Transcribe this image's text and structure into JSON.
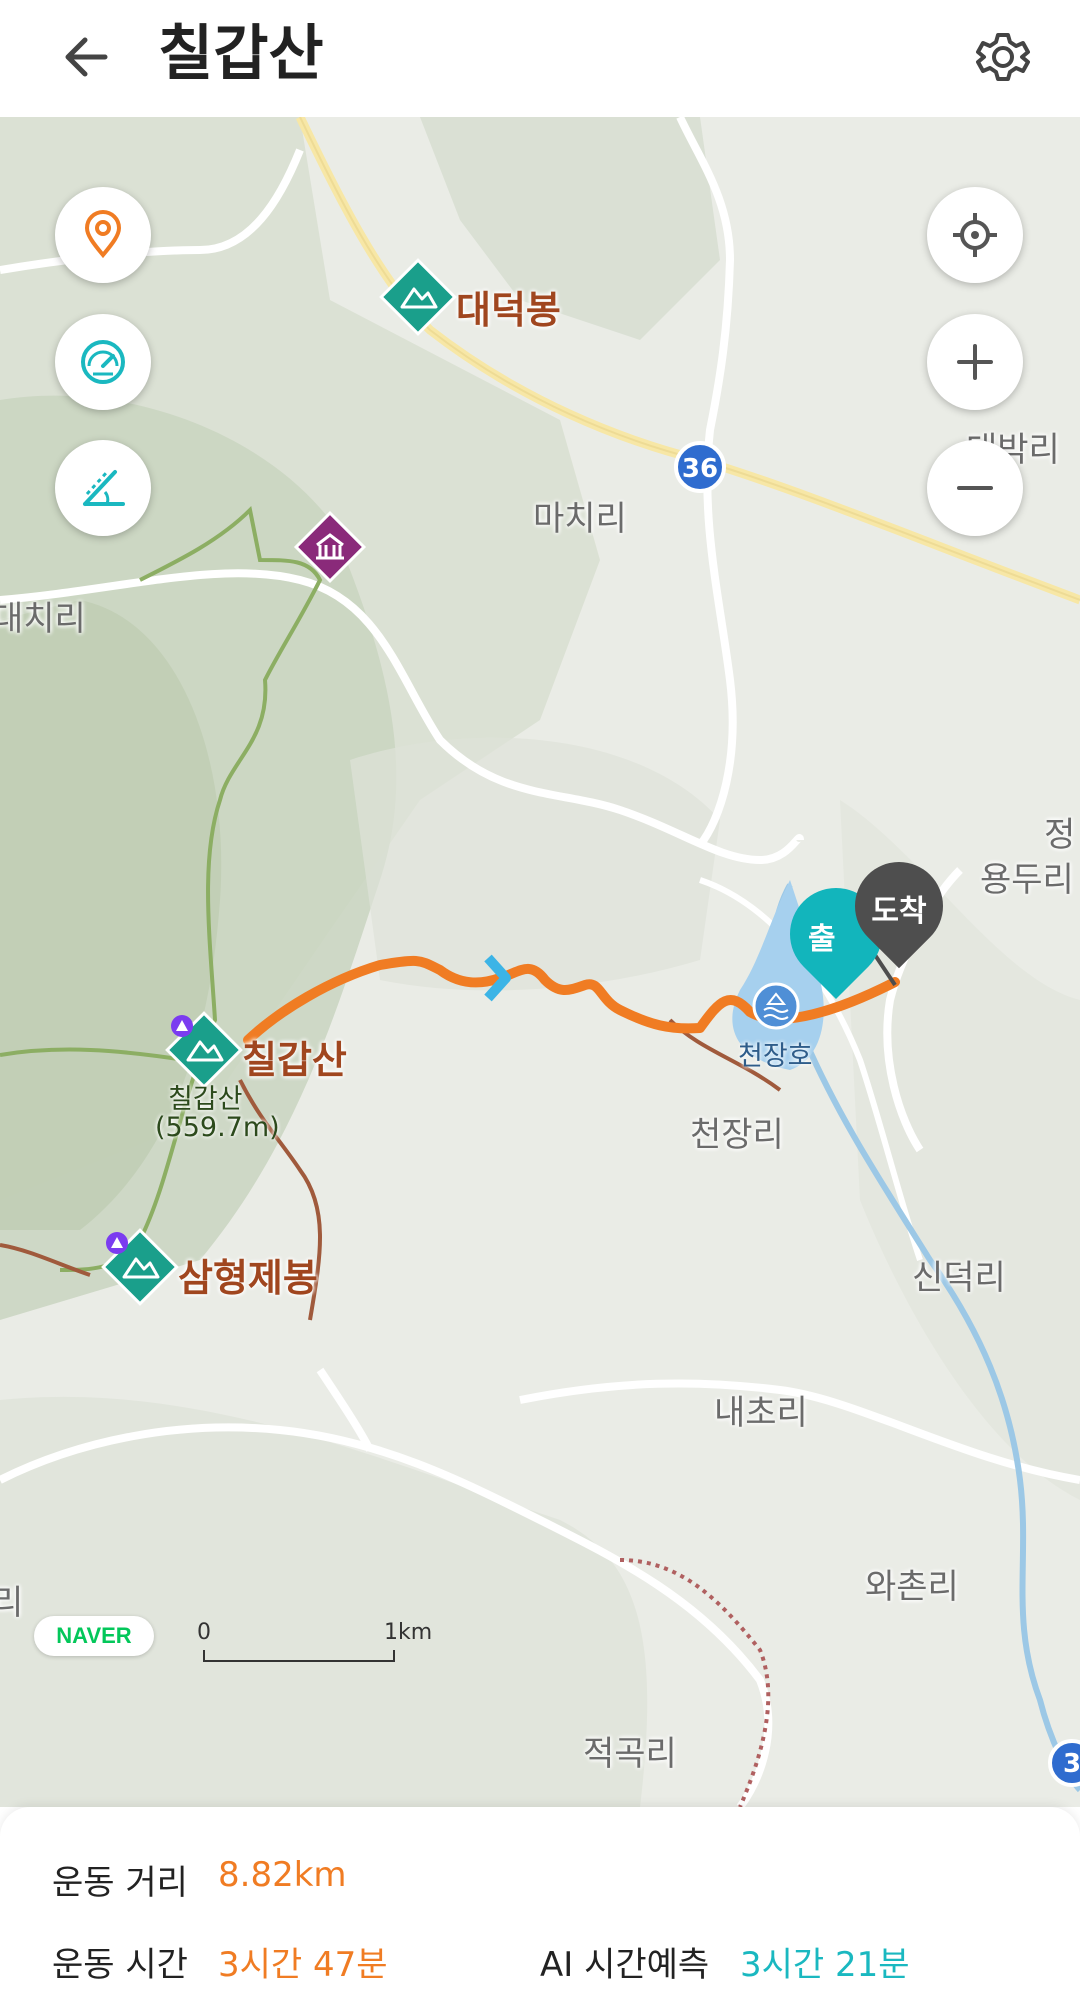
{
  "header": {
    "title": "칠갑산",
    "back_icon": "arrow-left-icon",
    "settings_icon": "gear-icon"
  },
  "map": {
    "place_labels": [
      "마치리",
      "대치리",
      "천장리",
      "용두리",
      "신덕리",
      "내초리",
      "와촌리",
      "적곡리",
      "대박리",
      "정"
    ],
    "peaks": [
      "대덕봉",
      "칠갑산",
      "삼형제봉"
    ],
    "summit": {
      "name": "칠갑산",
      "elevation": "(559.7m)"
    },
    "lake": "천장호",
    "road_number": "36",
    "road_number_edge": "3",
    "partial_label_left": "리",
    "pins": {
      "start": "출",
      "destination": "도착"
    },
    "provider": "NAVER",
    "scale": {
      "start": "0",
      "end": "1km"
    },
    "colors": {
      "route": "#f07c23",
      "start_pin": "#12b5bc",
      "dest_pin": "#4e4e4e",
      "peak_marker": "#1a9f8b",
      "temple_marker": "#8a2a7a"
    }
  },
  "controls": {
    "left": [
      "location-pin-icon",
      "speedometer-icon",
      "slope-icon"
    ],
    "right": [
      "crosshair-icon",
      "plus-icon",
      "minus-icon"
    ]
  },
  "stats": {
    "distance_label": "운동 거리",
    "distance_value": "8.82km",
    "time_label": "운동 시간",
    "time_value": "3시간 47분",
    "ai_label": "AI 시간예측",
    "ai_value": "3시간 21분"
  }
}
